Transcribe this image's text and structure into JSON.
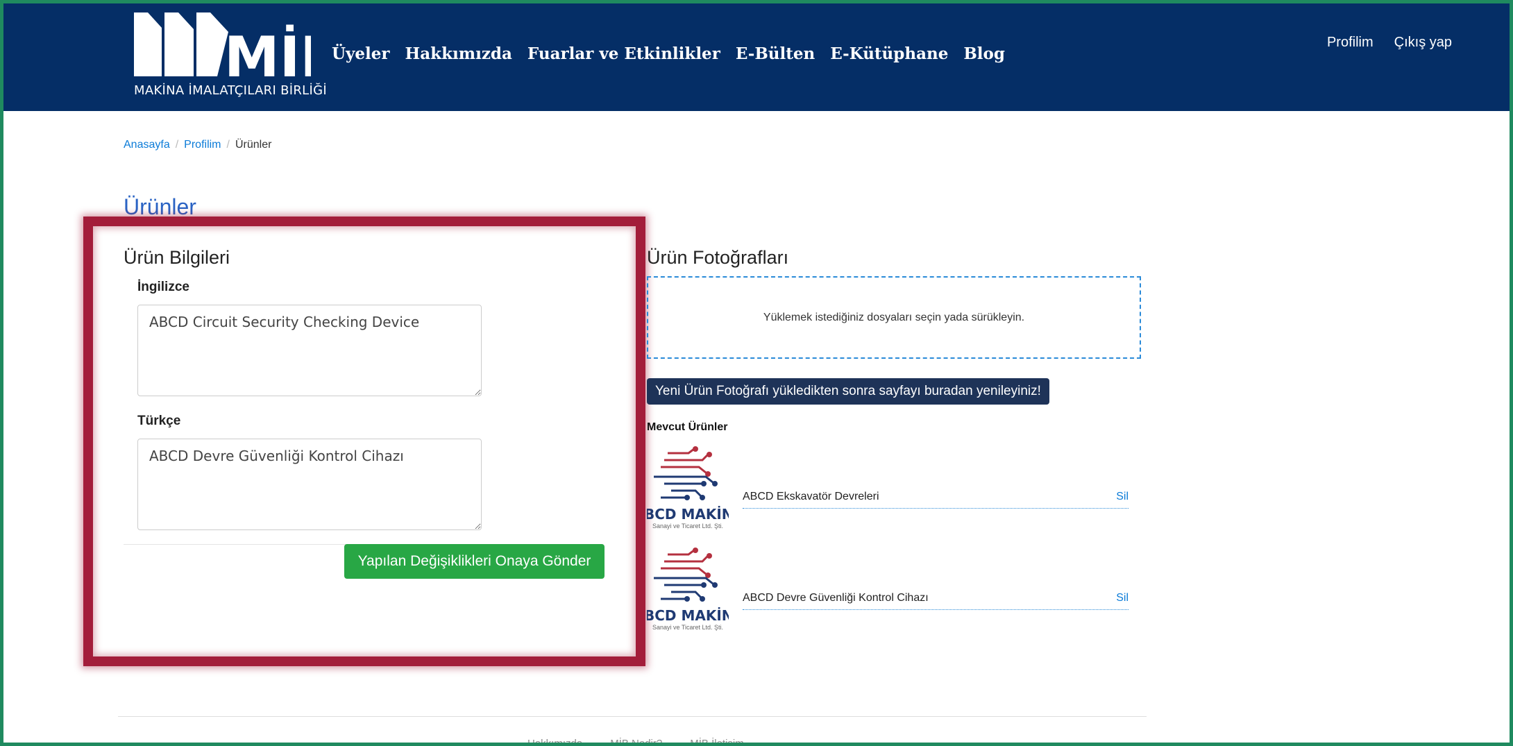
{
  "header": {
    "logo_text": "MİB",
    "logo_subtitle": "MAKİNA İMALATÇILARI BİRLİĞİ",
    "nav": [
      "Üyeler",
      "Hakkımızda",
      "Fuarlar ve Etkinlikler",
      "E-Bülten",
      "E-Kütüphane",
      "Blog"
    ],
    "profile_link": "Profilim",
    "logout_link": "Çıkış yap"
  },
  "breadcrumb": {
    "home": "Anasayfa",
    "profile": "Profilim",
    "current": "Ürünler",
    "sep": "/"
  },
  "page_title": "Ürünler",
  "product_info": {
    "title": "Ürün Bilgileri",
    "english_label": "İngilizce",
    "english_value": "ABCD Circuit Security Checking Device",
    "turkish_label": "Türkçe",
    "turkish_value": "ABCD Devre Güvenliği Kontrol Cihazı",
    "submit_label": "Yapılan Değişiklikleri Onaya Gönder"
  },
  "photos": {
    "title": "Ürün Fotoğrafları",
    "dropzone_text": "Yüklemek istediğiniz dosyaları seçin yada sürükleyin.",
    "reload_label": "Yeni Ürün Fotoğrafı yükledikten sonra sayfayı buradan yenileyiniz!",
    "existing_title": "Mevcut Ürünler",
    "items": [
      {
        "name": "ABCD Ekskavatör Devreleri",
        "delete": "Sil",
        "brand": "BCD MAKİN",
        "brand_sub": "Sanayi ve Ticaret Ltd. Şti."
      },
      {
        "name": "ABCD Devre Güvenliği Kontrol Cihazı",
        "delete": "Sil",
        "brand": "BCD MAKİN",
        "brand_sub": "Sanayi ve Ticaret Ltd. Şti."
      }
    ]
  },
  "footer": {
    "links": [
      "Hakkımızda",
      "MİB Nedir?",
      "MİB İletişim"
    ]
  },
  "colors": {
    "header_bg": "#052e66",
    "highlight": "#a31d3a",
    "submit_green": "#28a745",
    "link_blue": "#0b7bd8"
  }
}
